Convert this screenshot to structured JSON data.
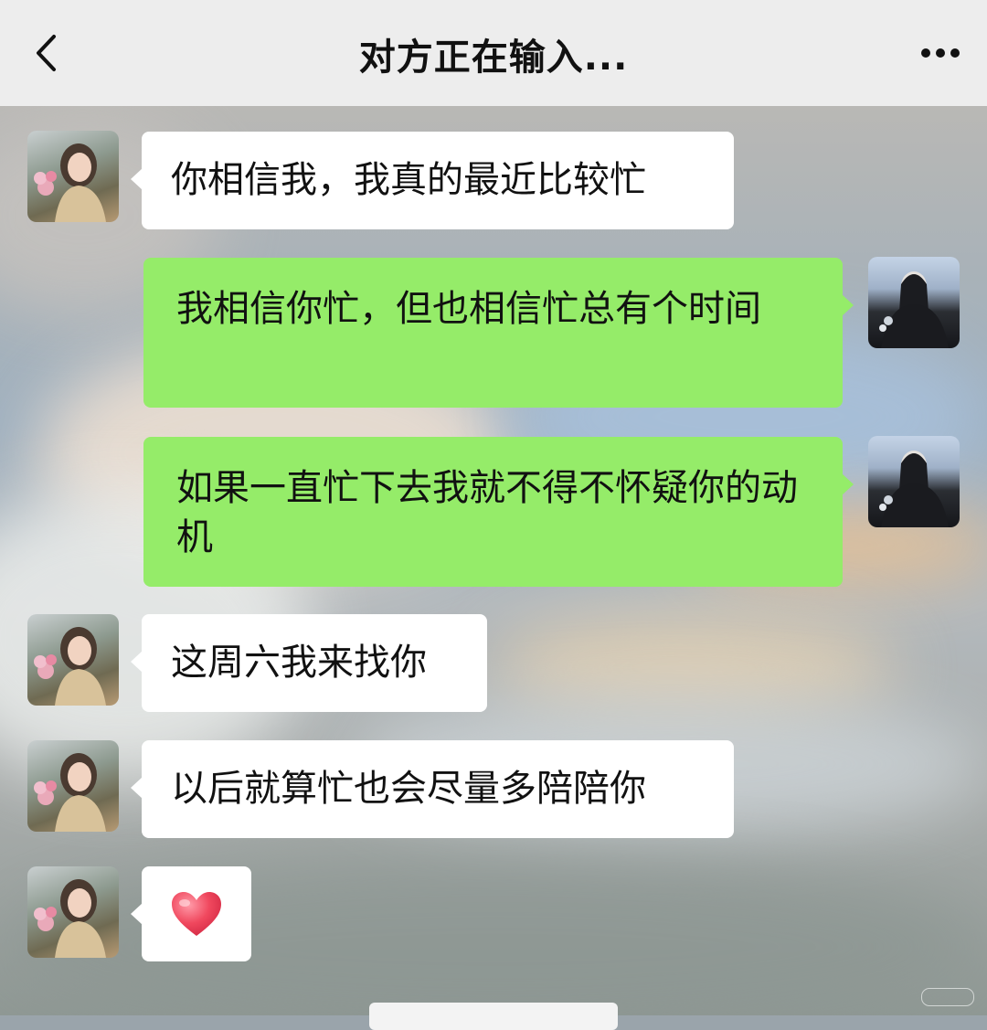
{
  "header": {
    "back_icon": "chevron-left-icon",
    "title": "对方正在输入...",
    "more_icon": "more-dots-icon"
  },
  "colors": {
    "header_bg": "#ededed",
    "incoming_bubble": "#ffffff",
    "outgoing_bubble": "#95ec69"
  },
  "messages": [
    {
      "side": "incoming",
      "text": "你相信我，我真的最近比较忙"
    },
    {
      "side": "outgoing",
      "text": "我相信你忙，但也相信忙总有个时间"
    },
    {
      "side": "outgoing",
      "text": "如果一直忙下去我就不得不怀疑你的动机"
    },
    {
      "side": "incoming",
      "text": "这周六我来找你"
    },
    {
      "side": "incoming",
      "text": "以后就算忙也会尽量多陪陪你"
    },
    {
      "side": "incoming",
      "icon": "heart-emoji-icon"
    }
  ]
}
